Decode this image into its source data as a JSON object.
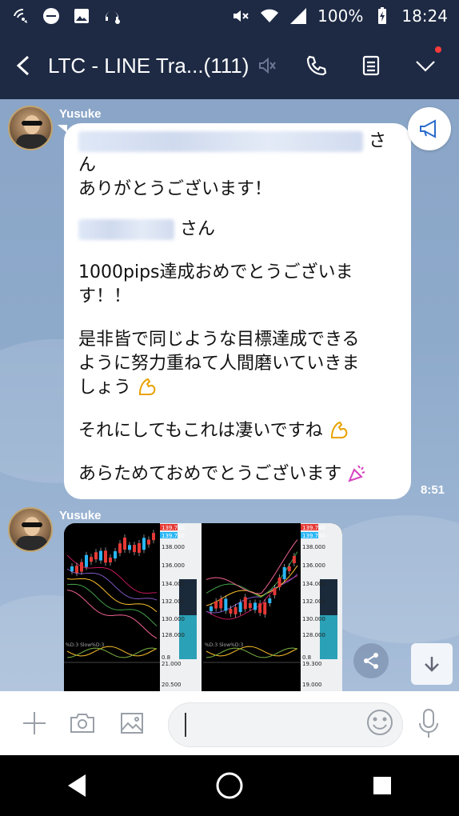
{
  "status_bar": {
    "battery": "100%",
    "time": "18:24",
    "left_icons": [
      "wifi-calling-icon",
      "do-not-disturb-icon",
      "image-icon",
      "headset-icon"
    ],
    "right_icons": [
      "mute-icon",
      "wifi-icon",
      "signal-icon",
      "battery-charging-icon"
    ]
  },
  "header": {
    "title": "LTC - LINE Tra...(111)",
    "buttons": [
      "back-icon",
      "call-icon",
      "notes-icon",
      "chevron-down-icon"
    ]
  },
  "messages": [
    {
      "sender": "Yusuke",
      "time": "8:51",
      "lines": {
        "l1_suffix": "さ",
        "l2": "ん",
        "l3": "ありがとうございます！",
        "l4_suffix": "さん",
        "l5": "1000pips達成おめでとうございま",
        "l6": "す！！",
        "l7": "是非皆で同じような目標達成できる",
        "l8": "ように努力重ねて人間磨いていきま",
        "l9": "しょう",
        "l10": "それにしてもこれは凄いですね",
        "l11": "あらためておめでとうございます"
      }
    },
    {
      "sender": "Yusuke",
      "type": "image",
      "chart_labels_left": [
        "139.740",
        "139.730",
        "138.000",
        "136.000",
        "134.000",
        "132.000",
        "130.000",
        "128.000",
        "0.8",
        "21.000",
        "20.500"
      ],
      "chart_labels_right": [
        "139.740",
        "139.730",
        "138.000",
        "136.000",
        "134.000",
        "132.000",
        "130.000",
        "128.000",
        "0.8",
        "19.300",
        "19.000"
      ],
      "indicator_left": "%D:3  Slow%D:3",
      "indicator_right": "%D:3  Slow%D:3"
    }
  ],
  "input": {
    "placeholder": "",
    "value": ""
  },
  "colors": {
    "header_bg": "#1e2a44",
    "chat_bg": "#8eaacb",
    "accent_blue": "#2b6bcc"
  }
}
